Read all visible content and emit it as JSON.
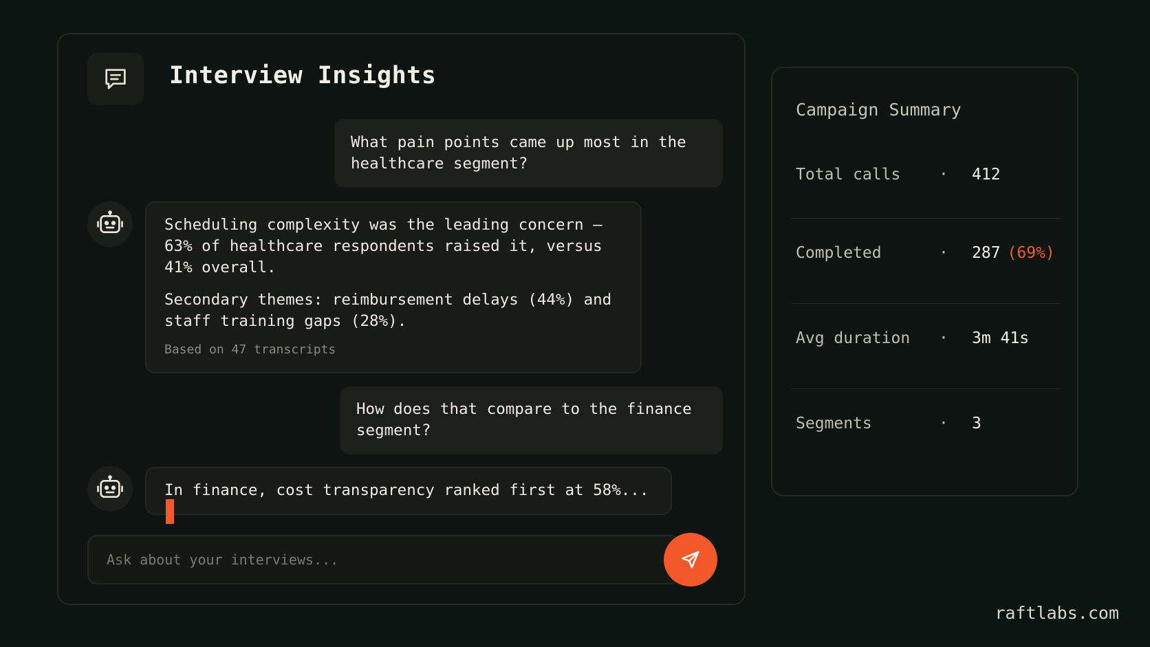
{
  "chat": {
    "title": "Interview Insights",
    "header_icon": "chat-bubble-icon",
    "messages": [
      {
        "role": "user",
        "text": "What pain points came up most in the healthcare segment?"
      },
      {
        "role": "assistant",
        "paragraphs": [
          "Scheduling complexity was the leading concern — 63% of healthcare respondents raised it, versus 41% overall.",
          "Secondary themes: reimbursement delays (44%) and staff training gaps (28%)."
        ],
        "meta": "Based on 47 transcripts",
        "avatar_icon": "robot-icon"
      },
      {
        "role": "user",
        "text": "How does that compare to the finance segment?"
      },
      {
        "role": "assistant",
        "text": "In finance, cost transparency ranked first at 58%...",
        "streaming": true,
        "avatar_icon": "robot-icon"
      }
    ],
    "input": {
      "placeholder": "Ask about your interviews...",
      "value": ""
    },
    "send_icon": "send-icon"
  },
  "summary": {
    "title": "Campaign Summary",
    "separator": "·",
    "rows": [
      {
        "label": "Total calls",
        "value": "412"
      },
      {
        "label": "Completed",
        "value": "287",
        "extra": "(69%)"
      },
      {
        "label": "Avg duration",
        "value": "3m 41s"
      },
      {
        "label": "Segments",
        "value": "3"
      }
    ]
  },
  "brand": "raftlabs.com",
  "colors": {
    "accent": "#f15a2b",
    "background": "#0b1512"
  }
}
